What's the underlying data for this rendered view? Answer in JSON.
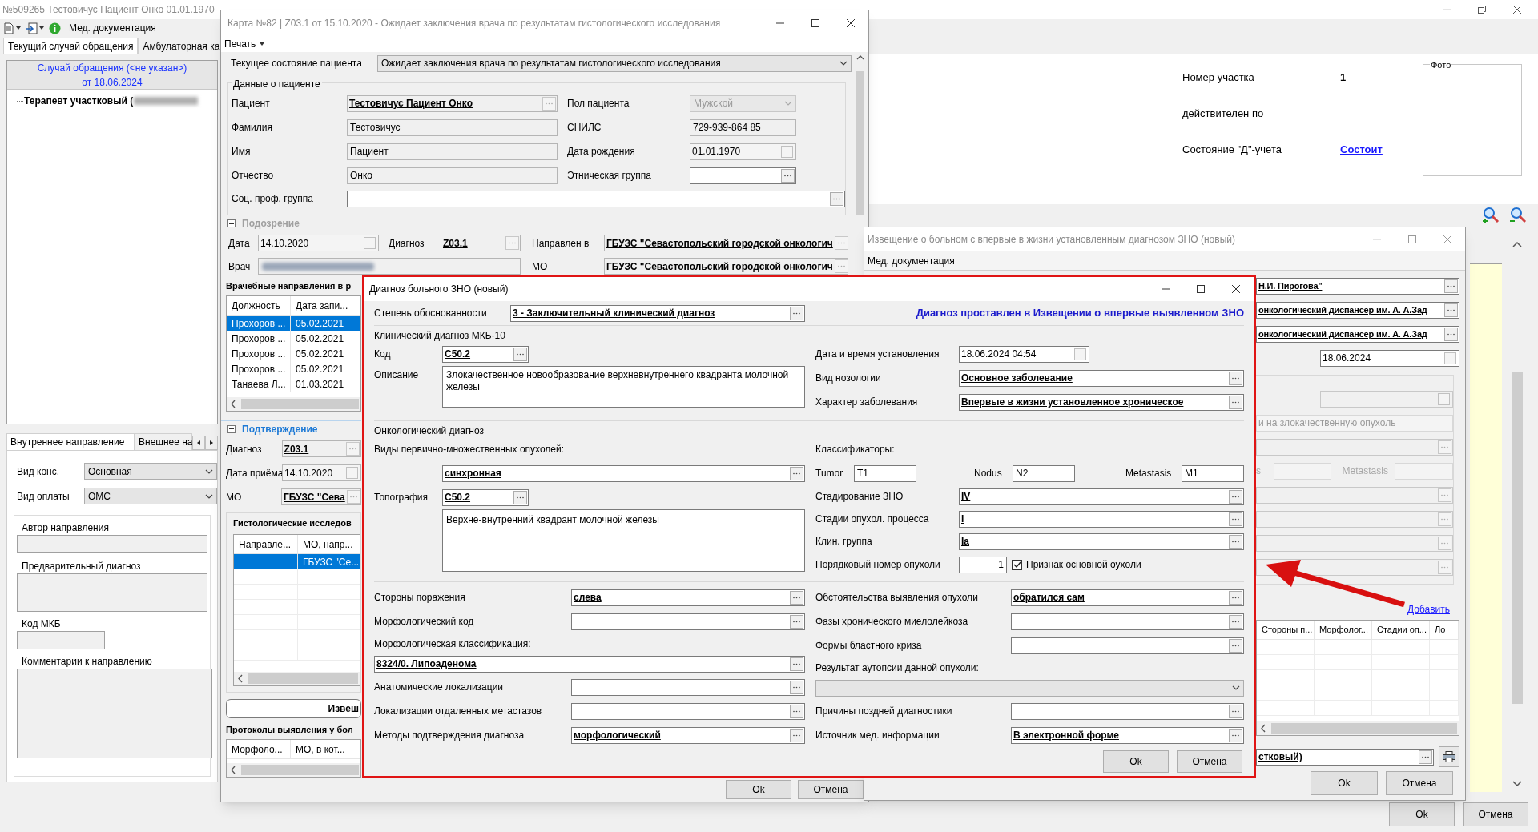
{
  "main_window": {
    "title": "№509265 Тестовичус Пациент Онко 01.01.1970",
    "toolbar_menu": "Мед. документация",
    "tabs": [
      {
        "label": "Текущий случай обращения",
        "selected": true
      },
      {
        "label": "Амбулаторная ка",
        "selected": false
      }
    ],
    "case_tree": {
      "header": [
        "Случай обращения (<не указан>)",
        "от 18.06.2024"
      ],
      "items": [
        {
          "label": "Терапевт участковый (",
          "redacted": true
        }
      ]
    },
    "referral_tabs": [
      {
        "label": "Внутреннее направление",
        "selected": true
      },
      {
        "label": "Внешнее на",
        "selected": false
      }
    ],
    "referral_fields": [
      {
        "label": "Вид конс.",
        "kind": "combo",
        "value": "Основная"
      },
      {
        "label": "Вид оплаты",
        "kind": "combo",
        "value": "ОМС"
      }
    ],
    "referral_groups": [
      {
        "label": "Автор направления",
        "kind": "line"
      },
      {
        "label": "Предварительный диагноз",
        "kind": "area"
      },
      {
        "label": "Код МКБ",
        "kind": "short"
      },
      {
        "label": "Комментарии к направлению",
        "kind": "big"
      }
    ],
    "district": [
      {
        "label": "Номер участка",
        "kind": "bold",
        "value": "1"
      },
      {
        "label": "действителен по",
        "kind": "plain"
      },
      {
        "label": "Состояние \"Д\"-учета",
        "kind": "link",
        "value": "Состоит"
      }
    ],
    "photo_label": "Фото",
    "buttons": [
      "Ok",
      "Отмена"
    ]
  },
  "card_window": {
    "title": "Карта №82 | Z03.1 от 15.10.2020 - Ожидает заключения врача по результатам гистологического исследования",
    "menu": "Печать",
    "state": {
      "label": "Текущее состояние пациента",
      "kind": "combo",
      "value": "Ожидает заключения врача по результатам гистологического исследования"
    },
    "patient": {
      "title": "Данные о пациенте",
      "left": [
        {
          "label": "Пациент",
          "kind": "lookup_ro",
          "value": "Тестовичус Пациент Онко"
        },
        {
          "label": "Фамилия",
          "kind": "readonly",
          "value": "Тестовичус"
        },
        {
          "label": "Имя",
          "kind": "readonly",
          "value": "Пациент"
        },
        {
          "label": "Отчество",
          "kind": "readonly",
          "value": "Онко"
        }
      ],
      "right": [
        {
          "label": "Пол пациента",
          "kind": "combo_disabled",
          "value": "Мужской"
        },
        {
          "label": "СНИЛС",
          "kind": "readonly",
          "value": "729-939-864 85"
        },
        {
          "label": "Дата рождения",
          "kind": "date_ro",
          "value": "01.01.1970"
        },
        {
          "label": "Этническая группа",
          "kind": "lookup"
        }
      ],
      "social": {
        "label": "Соц. проф. группа",
        "kind": "lookup"
      }
    },
    "suspicion": {
      "title": "Подозрение",
      "expanded": true,
      "active": false,
      "row1": [
        {
          "label": "Дата",
          "kind": "date_ro",
          "value": "14.10.2020"
        },
        {
          "label": "Диагноз",
          "kind": "lookup_ro",
          "value": "Z03.1"
        },
        {
          "label": "Направлен в",
          "kind": "lookup_ro",
          "value": "ГБУЗС \"Севастопольский городской онкологич"
        }
      ],
      "row2": [
        {
          "label": "Врач",
          "kind": "redacted"
        },
        {
          "label": "МО",
          "kind": "lookup_ro",
          "value": "ГБУЗС \"Севастопольский городской онкологич"
        }
      ]
    },
    "referrals": {
      "title": "Врачебные направления в р",
      "columns": [
        "Должность",
        "Дата запи..."
      ],
      "rows": [
        {
          "cells": [
            "Прохоров ...",
            "05.02.2021"
          ],
          "selected": true
        },
        {
          "cells": [
            "Прохоров ...",
            "05.02.2021"
          ],
          "selected": false
        },
        {
          "cells": [
            "Прохоров ...",
            "05.02.2021"
          ],
          "selected": false
        },
        {
          "cells": [
            "Прохоров ...",
            "05.02.2021"
          ],
          "selected": false
        },
        {
          "cells": [
            "Танаева Л...",
            "01.03.2021"
          ],
          "selected": false
        }
      ]
    },
    "confirmation": {
      "title": "Подтверждение",
      "expanded": true,
      "active": true,
      "fields": [
        {
          "label": "Диагноз",
          "kind": "lookup_ro",
          "value": "Z03.1"
        },
        {
          "label": "Дата приёма",
          "kind": "date_ro",
          "value": "14.10.2020"
        },
        {
          "label": "МО",
          "kind": "lookup_ro",
          "value": "ГБУЗС \"Сева"
        }
      ]
    },
    "histology": {
      "title": "Гистологические исследов",
      "columns": [
        "Направле...",
        "МО, напр..."
      ],
      "rows": [
        {
          "cells": [
            "",
            "ГБУЗС \"Се..."
          ],
          "selected": true
        }
      ]
    },
    "notice_button": "Извеш",
    "protocols": {
      "title": "Протоколы выявления у бол",
      "columns": [
        "Морфоло...",
        "МО, в кот..."
      ]
    },
    "buttons": [
      "Ok",
      "Отмена"
    ]
  },
  "notice_window": {
    "title": "Извещение о больном с впервые в жизни установленным диагнозом ЗНО (новый)",
    "menu": "Мед. документация",
    "fields": [
      {
        "kind": "lookup",
        "value": "Н.И. Пирогова\""
      },
      {
        "kind": "lookup",
        "value": "онкологический диспансер им. А. А.Зад"
      },
      {
        "kind": "lookup",
        "value": "онкологический диспансер им. А. А.Зад"
      },
      {
        "kind": "date",
        "value": "18.06.2024"
      }
    ],
    "group": [
      {
        "kind": "disabled_date"
      },
      {
        "kind": "disabled_text",
        "value": "и на злокачественную опухоль"
      },
      {
        "kind": "disabled_lookup"
      },
      {
        "kind": "tnm",
        "labels": [
          "s",
          "Metastasis"
        ]
      },
      {
        "kind": "disabled_lookup"
      },
      {
        "kind": "disabled_lookup"
      },
      {
        "kind": "disabled_lookup"
      },
      {
        "kind": "disabled_lookup"
      }
    ],
    "add_link": "Добавить",
    "columns": [
      "Стороны п...",
      "Морфолог...",
      "Стадии оп...",
      "Ло"
    ],
    "doctor": {
      "kind": "lookup",
      "value": "стковый)"
    },
    "buttons": [
      "Ok",
      "Отмена"
    ]
  },
  "diagnosis_dialog": {
    "title": "Диагноз больного ЗНО (новый)",
    "notice": "Диагноз проставлен в Извещении о впервые выявленном ЗНО",
    "justification": {
      "label": "Степень обоснованности",
      "kind": "lookup",
      "value": "3 - Заключительный клинический диагноз"
    },
    "icd": {
      "title": "Клинический диагноз МКБ-10",
      "code": {
        "label": "Код",
        "kind": "lookup",
        "value": "C50.2"
      },
      "description": {
        "label": "Описание",
        "value": "Злокачественное новообразование верхневнутреннего квадранта молочной железы"
      },
      "right": [
        {
          "label": "Дата и время установления",
          "kind": "date",
          "value": "18.06.2024 04:54"
        },
        {
          "label": "Вид нозологии",
          "kind": "lookup",
          "value": "Основное заболевание"
        },
        {
          "label": "Характер заболевания",
          "kind": "lookup",
          "value": "Впервые в жизни установленное хроническое"
        }
      ]
    },
    "onco": {
      "title": "Онкологический диагноз",
      "multiple_label": "Виды первично-множественных опухолей:",
      "multiple": {
        "kind": "lookup",
        "value": "синхронная"
      },
      "topography": {
        "label": "Топография",
        "kind": "lookup",
        "value": "C50.2"
      },
      "topography_description": "Верхне-внутренний квадрант молочной железы",
      "classifiers_label": "Классификаторы:",
      "tnm": [
        {
          "label": "Tumor",
          "value": "T1"
        },
        {
          "label": "Nodus",
          "value": "N2"
        },
        {
          "label": "Metastasis",
          "value": "M1"
        }
      ],
      "right": [
        {
          "label": "Стадирование ЗНО",
          "kind": "lookup",
          "value": "IV"
        },
        {
          "label": "Стадии опухол. процесса",
          "kind": "lookup",
          "value": "I"
        },
        {
          "label": "Клин. группа",
          "kind": "lookup",
          "value": "Ia"
        }
      ],
      "order": {
        "label": "Порядковый номер опухоли",
        "value": "1"
      },
      "main_tumor": {
        "label": "Признак основной оухоли",
        "checked": true
      }
    },
    "left_fields": [
      {
        "label": "Стороны поражения",
        "kind": "lookup",
        "value": "слева"
      },
      {
        "label": "Морфологический код",
        "kind": "lookup"
      },
      {
        "label": "Морфологическая классификация:",
        "kind": "lookup_wide",
        "value": "8324/0. Липоаденома"
      },
      {
        "label": "Анатомические локализации",
        "kind": "lookup"
      },
      {
        "label": "Локализации отдаленных метастазов",
        "kind": "lookup"
      },
      {
        "label": "Методы подтверждения диагноза",
        "kind": "lookup",
        "value": "морфологический"
      }
    ],
    "right_fields": [
      {
        "label": "Обстоятельства выявления опухоли",
        "kind": "lookup",
        "value": "обратился сам"
      },
      {
        "label": "Фазы хронического миелолейкоза",
        "kind": "lookup"
      },
      {
        "label": "Формы бластного криза",
        "kind": "lookup"
      },
      {
        "label": "Результат аутопсии данной опухоли:",
        "kind": "combo_wide"
      },
      {
        "label": "Причины поздней диагностики",
        "kind": "lookup"
      },
      {
        "label": "Источник мед. информации",
        "kind": "lookup",
        "value": "В электронной форме"
      }
    ],
    "buttons": [
      "Ok",
      "Отмена"
    ]
  }
}
